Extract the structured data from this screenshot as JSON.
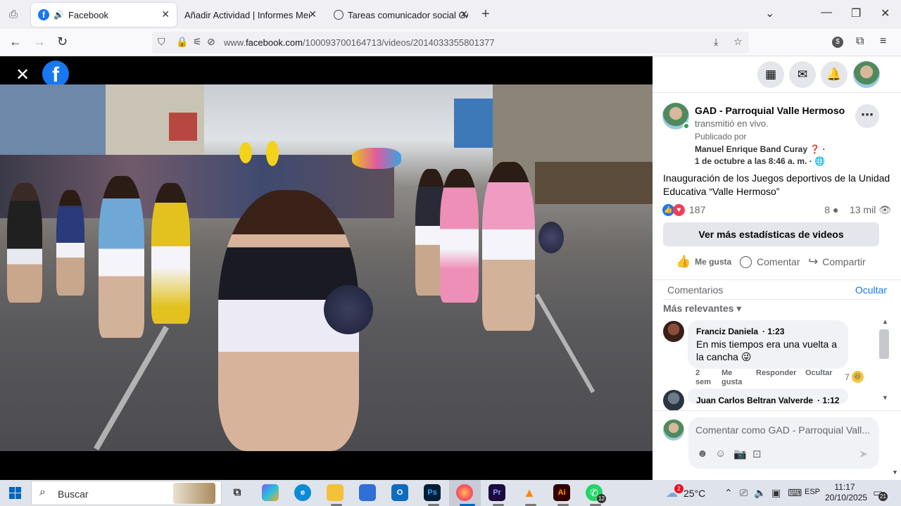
{
  "browser": {
    "tabs": [
      {
        "title": "Facebook",
        "close": "✕"
      },
      {
        "title": "Añadir Actividad | Informes Mensua",
        "close": "✕"
      },
      {
        "title": "Tareas comunicador social GAD",
        "close": "✕"
      }
    ],
    "new_tab": "+",
    "url_prefix": "www.",
    "url_domain": "facebook.com",
    "url_path": "/100093700164713/videos/2014033355801377"
  },
  "viewer": {
    "close": "✕",
    "logo": "f"
  },
  "post": {
    "page_name": "GAD - Parroquial Valle Hermoso",
    "action": "transmitió en vivo.",
    "published_by_label": "Publicado por",
    "author": "Manuel Enrique Band Curay",
    "author_suffix": "❓ ·",
    "date": "1 de octubre a las 8:46 a. m.",
    "date_suffix": "· 🌐",
    "description": "Inauguración de los Juegos deportivos de la Unidad Educativa “Valle Hermoso”",
    "reaction_count": "187",
    "comments_count": "8",
    "views": "13 mil",
    "stats_button": "Ver más estadísticas de videos",
    "like_label": "Me gusta",
    "comment_label": "Comentar",
    "share_label": "Compartir"
  },
  "comments": {
    "header": "Comentarios",
    "hide": "Ocultar",
    "sort": "Más relevantes",
    "items": [
      {
        "name": "Franciz Daniela",
        "time": "1:23",
        "text": "En mis tiempos era una vuelta a la cancha 😜",
        "age": "2 sem",
        "like": "Me gusta",
        "reply": "Responder",
        "hide": "Ocultar",
        "reactions": "7"
      },
      {
        "name": "Juan Carlos Beltran Valverde",
        "time": "1:12"
      }
    ],
    "composer_placeholder": "Comentar como GAD - Parroquial Vall..."
  },
  "taskbar": {
    "search_label": "Buscar",
    "temperature": "25°C",
    "weather_badge": "2",
    "lang": "ESP",
    "time": "11:17",
    "date": "20/10/2025",
    "whatsapp_badge": "12",
    "notifications_badge": "21",
    "apps": [
      {
        "name": "task-view",
        "label": "⧉",
        "color": "#dfe3ec"
      },
      {
        "name": "copilot",
        "label": "",
        "color": "#7a5af8"
      },
      {
        "name": "edge",
        "label": "e",
        "color": "#0c8ad6"
      },
      {
        "name": "file-explorer",
        "label": "",
        "color": "#f3c13a"
      },
      {
        "name": "microsoft-store",
        "label": "",
        "color": "#2f6fd6"
      },
      {
        "name": "outlook",
        "label": "O",
        "color": "#0f6cbd"
      },
      {
        "name": "photoshop",
        "label": "Ps",
        "color": "#001e36"
      },
      {
        "name": "firefox",
        "label": "",
        "color": "#ff7139"
      },
      {
        "name": "premiere",
        "label": "Pr",
        "color": "#1a0a3e"
      },
      {
        "name": "vlc",
        "label": "▲",
        "color": "#ff8800"
      },
      {
        "name": "illustrator",
        "label": "Ai",
        "color": "#330000"
      },
      {
        "name": "whatsapp",
        "label": "✆",
        "color": "#25d366"
      }
    ]
  },
  "colors": {
    "facebook_blue": "#1877f2",
    "love_red": "#f33e58",
    "panel_bg": "#ffffff"
  }
}
